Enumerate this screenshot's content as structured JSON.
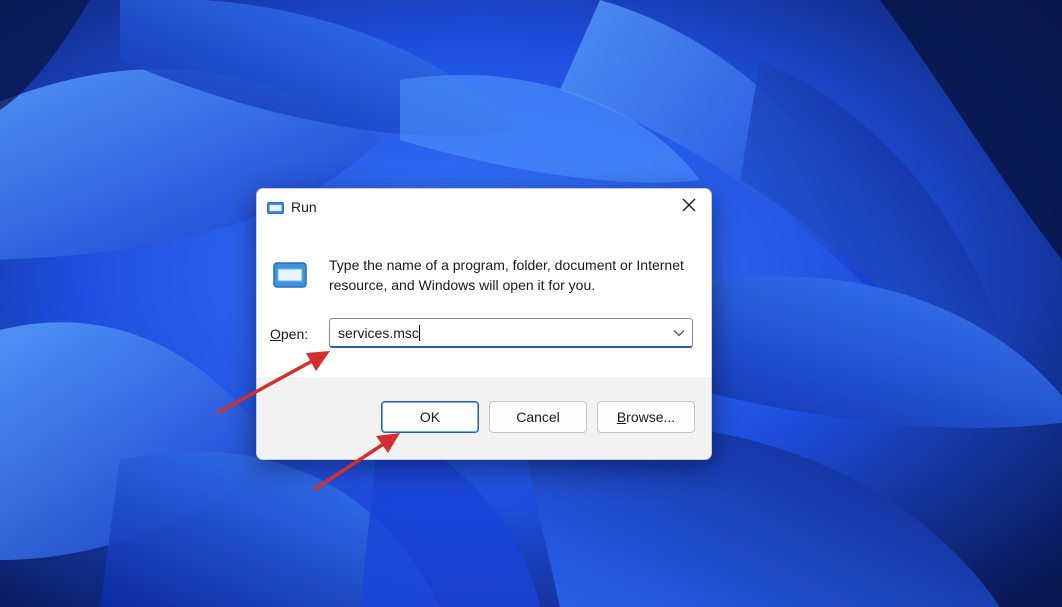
{
  "dialog": {
    "title": "Run",
    "description": "Type the name of a program, folder, document or Internet resource, and Windows will open it for you.",
    "open_label_access_key": "O",
    "open_label_rest": "pen:",
    "open_value": "services.msc",
    "buttons": {
      "ok": "OK",
      "cancel": "Cancel",
      "browse_access_key": "B",
      "browse_rest": "rowse..."
    }
  },
  "icons": {
    "title": "run-icon",
    "body": "run-icon",
    "close": "close-icon",
    "dropdown": "chevron-down-icon",
    "annotations": "red-arrow-icon"
  },
  "colors": {
    "accent": "#2a5db0",
    "annotation_arrow": "#d32f2f",
    "wallpaper_dark": "#0a1a5c",
    "wallpaper_bright": "#2f6bff"
  }
}
